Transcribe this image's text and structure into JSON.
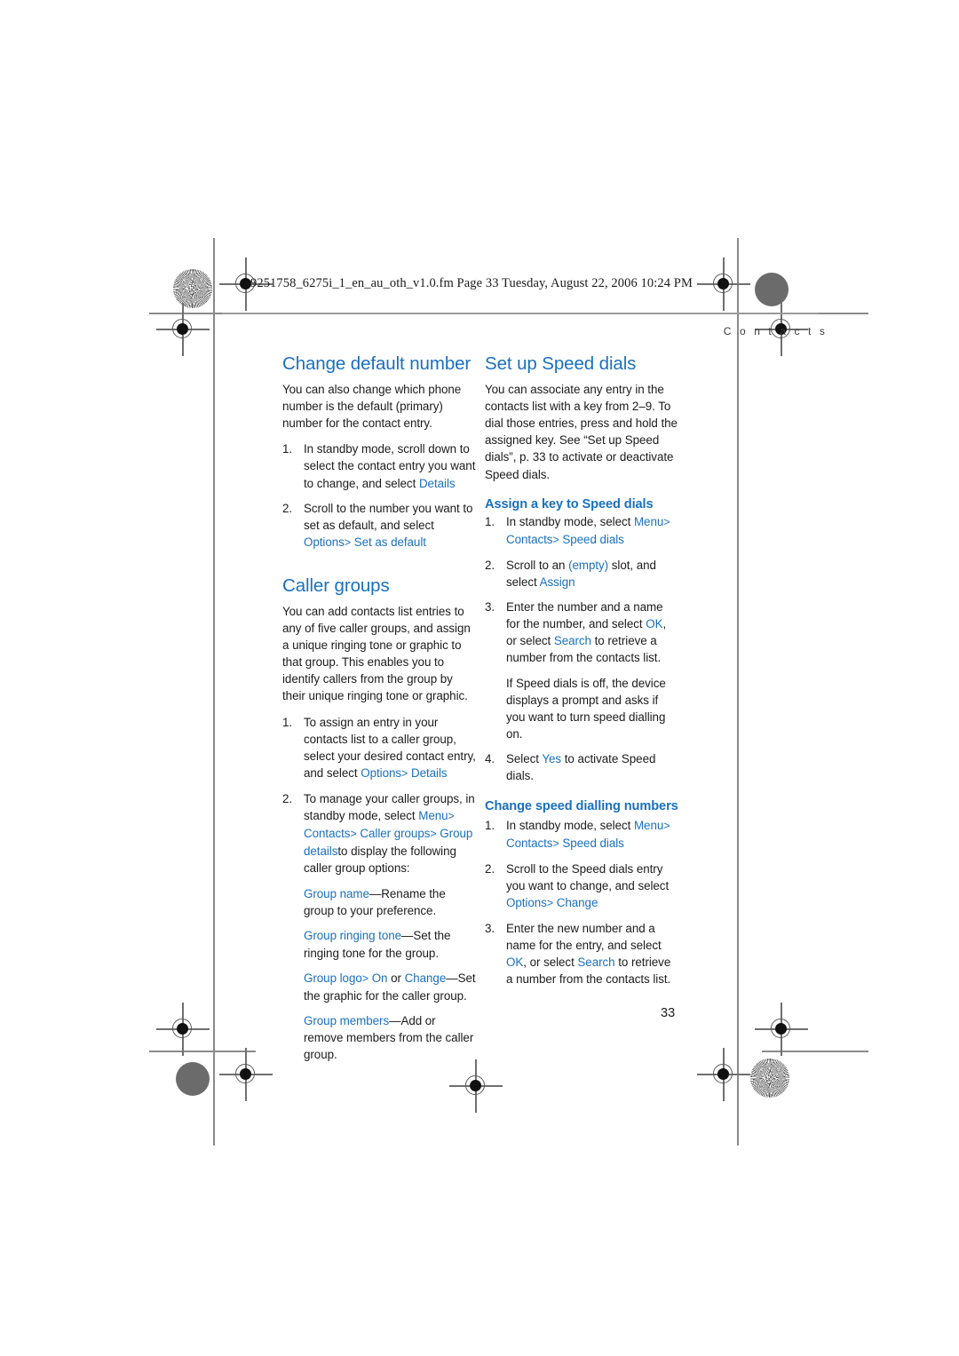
{
  "print_marks": {
    "filestamp": "9251758_6275i_1_en_au_oth_v1.0.fm  Page 33  Tuesday, August 22, 2006  10:24 PM"
  },
  "header": {
    "running_head": "C o n t a c t s"
  },
  "colors": {
    "accent_blue": "#1a70bf",
    "body_text": "#1c1c1c",
    "rule_gray": "#9a9a9a"
  },
  "left_column": {
    "section1": {
      "heading": "Change default number",
      "intro": "You can also change which phone number is the default (primary) number for the contact entry.",
      "steps": [
        {
          "num": "1.",
          "text_a": "In standby mode, scroll down to select the contact entry you want to change, and select ",
          "ui_a": "Details"
        },
        {
          "num": "2.",
          "text_a": "Scroll to the number you want to set as default, and select ",
          "ui_a": "Options",
          "arrow": ">",
          "ui_b": "Set as default"
        }
      ]
    },
    "section2": {
      "heading": "Caller groups",
      "intro": "You can add contacts list entries to any of five caller groups, and assign a unique ringing tone or graphic to that group. This enables you to identify callers from the group by their unique ringing tone or graphic.",
      "steps": [
        {
          "num": "1.",
          "text_a": "To assign an entry in your contacts list to a caller group, select your desired contact entry, and select ",
          "ui_a": "Options",
          "arrow": ">",
          "ui_b": "Details"
        },
        {
          "num": "2.",
          "text_a": "To manage your caller groups, in standby mode, select ",
          "ui_a": "Menu",
          "arrow1": ">",
          "ui_b": "Contacts",
          "arrow2": ">",
          "ui_c": "Caller groups",
          "arrow3": ">",
          "ui_d": "Group details",
          "text_b": "to display the following caller group options:"
        }
      ],
      "options": [
        {
          "ui": "Group name",
          "dash": "—",
          "text": "Rename the group to your preference."
        },
        {
          "ui": "Group ringing tone",
          "dash": "—",
          "text": "Set the ringing tone for the group."
        },
        {
          "ui": "Group logo",
          "arrow": ">",
          "ui_b": "On",
          "mid": " or ",
          "ui_c": "Change",
          "dash": "—",
          "text": "Set the graphic for the caller group."
        },
        {
          "ui": "Group members",
          "dash": "—",
          "text": "Add or remove members from the caller group."
        }
      ]
    }
  },
  "right_column": {
    "section1": {
      "heading": "Set up Speed dials",
      "intro": "You can associate any entry in the contacts list with a key from 2–9. To dial those entries, press and hold the assigned key. See “Set up Speed dials”, p. 33 to activate or deactivate Speed dials."
    },
    "subsection1": {
      "heading": "Assign a key to Speed dials",
      "steps": [
        {
          "num": "1.",
          "text_a": "In standby mode, select ",
          "ui_a": "Menu",
          "arrow1": ">",
          "ui_b": "Contacts",
          "arrow2": ">",
          "ui_c": "Speed dials"
        },
        {
          "num": "2.",
          "text_a": "Scroll to an ",
          "ui_a": "(empty)",
          "text_b": " slot, and select ",
          "ui_b": "Assign"
        },
        {
          "num": "3.",
          "text_a": "Enter the number and a name for the number, and select ",
          "ui_a": "OK",
          "text_b": ", or select ",
          "ui_b": "Search",
          "text_c": " to retrieve a number from the contacts list.",
          "continuation": "If Speed dials is off, the device displays a prompt and asks if you want to turn speed dialling on."
        },
        {
          "num": "4.",
          "text_a": "Select ",
          "ui_a": "Yes",
          "text_b": " to activate Speed dials."
        }
      ]
    },
    "section2": {
      "heading": "Change speed dialling numbers",
      "steps": [
        {
          "num": "1.",
          "text_a": "In standby mode, select ",
          "ui_a": "Menu",
          "arrow1": ">",
          "ui_b": "Contacts",
          "arrow2": ">",
          "ui_c": "Speed dials"
        },
        {
          "num": "2.",
          "text_a": "Scroll to the Speed dials entry you want to change, and select ",
          "ui_a": "Options",
          "arrow1": ">",
          "ui_b": "Change"
        },
        {
          "num": "3.",
          "text_a": "Enter the new number and a name for the entry, and select ",
          "ui_a": "OK",
          "text_b": ", or select ",
          "ui_b": "Search",
          "text_c": " to retrieve a number from the contacts list."
        }
      ]
    }
  },
  "footer": {
    "page_number": "33"
  }
}
